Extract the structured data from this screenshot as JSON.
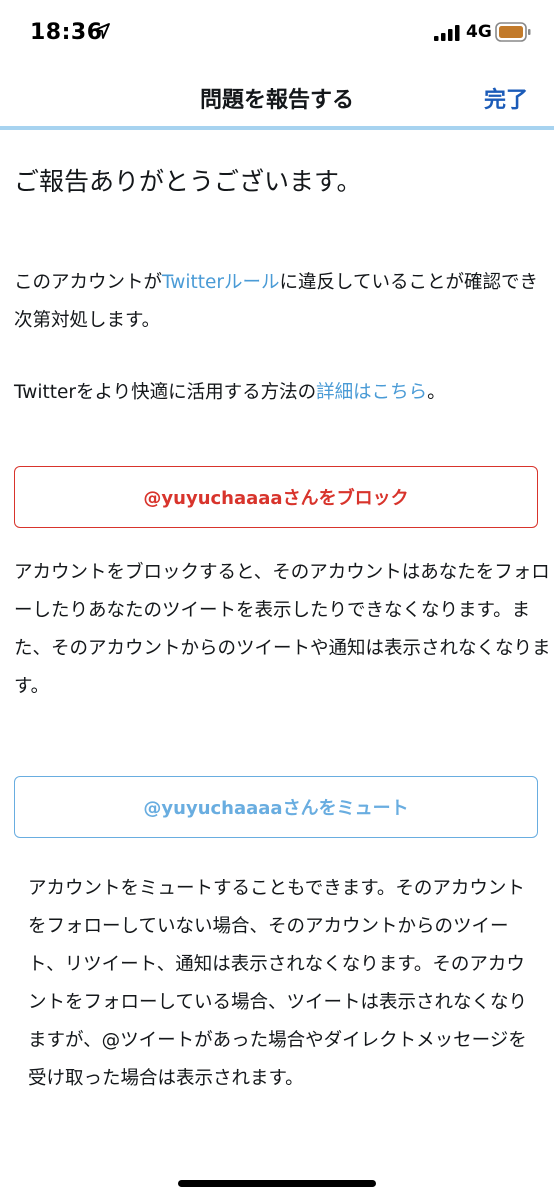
{
  "status_bar": {
    "time": "18:36",
    "network": "4G",
    "icons": [
      "location-arrow-icon",
      "signal-icon",
      "battery-icon"
    ],
    "battery_color": "#c27a2a"
  },
  "nav": {
    "title": "問題を報告する",
    "done_label": "完了"
  },
  "content": {
    "heading": "ご報告ありがとうございます。",
    "p1": {
      "before": "このアカウントが",
      "link": "Twitterルール",
      "after": "に違反していることが確認でき次第対処します。"
    },
    "p2": {
      "before": "Twitterをより快適に活用する方法の",
      "link": "詳細はこちら",
      "after": "。"
    },
    "block_button": "@yuyuchaaaaさんをブロック",
    "block_description": "アカウントをブロックすると、そのアカウントはあなたをフォローしたりあなたのツイートを表示したりできなくなります。また、そのアカウントからのツイートや通知は表示されなくなります。",
    "mute_button": "@yuyuchaaaaさんをミュート",
    "mute_description": "アカウントをミュートすることもできます。そのアカウントをフォローしていない場合、そのアカウントからのツイート、リツイート、通知は表示されなくなります。そのアカウントをフォローしている場合、ツイートは表示されなくなりますが、@ツイートがあった場合やダイレクトメッセージを受け取った場合は表示されます。"
  },
  "colors": {
    "accent_blue": "#1b5bb8",
    "link_blue": "#4a9bd6",
    "danger_red": "#d8342c",
    "mute_blue": "#69ade0",
    "divider": "#a7d3f0"
  }
}
